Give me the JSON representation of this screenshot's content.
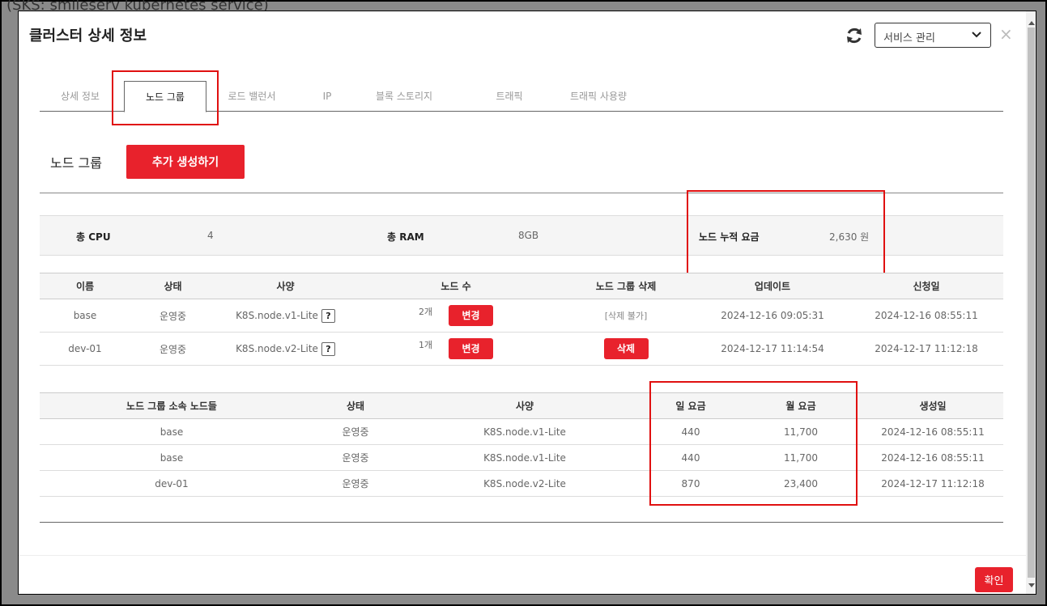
{
  "backdrop": {
    "title": "(SKS: smileserv kubernetes service)"
  },
  "modal": {
    "title": "클러스터 상세 정보",
    "service_select": "서비스 관리",
    "close": "×",
    "ok_label": "확인"
  },
  "tabs": [
    {
      "label": "상세 정보",
      "active": false
    },
    {
      "label": "노드 그룹",
      "active": true
    },
    {
      "label": "로드 밸런서",
      "active": false
    },
    {
      "label": "IP",
      "active": false
    },
    {
      "label": "블록 스토리지",
      "active": false
    },
    {
      "label": "트래픽",
      "active": false
    },
    {
      "label": "트래픽 사용량",
      "active": false
    }
  ],
  "section": {
    "title": "노드 그룹",
    "add_label": "추가 생성하기"
  },
  "summary": {
    "cpu_label": "총 CPU",
    "cpu_value": "4",
    "ram_label": "총 RAM",
    "ram_value": "8GB",
    "cost_label": "노드 누적 요금",
    "cost_value": "2,630 원"
  },
  "group_table": {
    "headers": [
      "이름",
      "상태",
      "사양",
      "노드 수",
      "노드 그룹 삭제",
      "업데이트",
      "신청일"
    ],
    "help_glyph": "?",
    "change_label": "변경",
    "rows": [
      {
        "name": "base",
        "status": "운영중",
        "spec": "K8S.node.v1-Lite",
        "count": "2개",
        "delete": "[삭제 불가]",
        "delete_is_button": false,
        "updated": "2024-12-16 09:05:31",
        "applied": "2024-12-16 08:55:11"
      },
      {
        "name": "dev-01",
        "status": "운영중",
        "spec": "K8S.node.v2-Lite",
        "count": "1개",
        "delete": "삭제",
        "delete_is_button": true,
        "updated": "2024-12-17 11:14:54",
        "applied": "2024-12-17 11:12:18"
      }
    ]
  },
  "node_table": {
    "headers": [
      "노드 그룹 소속 노드들",
      "상태",
      "사양",
      "일 요금",
      "월 요금",
      "생성일"
    ],
    "rows": [
      {
        "group": "base",
        "status": "운영중",
        "spec": "K8S.node.v1-Lite",
        "daily": "440",
        "monthly": "11,700",
        "created": "2024-12-16 08:55:11"
      },
      {
        "group": "base",
        "status": "운영중",
        "spec": "K8S.node.v1-Lite",
        "daily": "440",
        "monthly": "11,700",
        "created": "2024-12-16 08:55:11"
      },
      {
        "group": "dev-01",
        "status": "운영중",
        "spec": "K8S.node.v2-Lite",
        "daily": "870",
        "monthly": "23,400",
        "created": "2024-12-17 11:12:18"
      }
    ]
  },
  "colors": {
    "accent": "#e8222c",
    "highlight_box": "#e01010"
  }
}
